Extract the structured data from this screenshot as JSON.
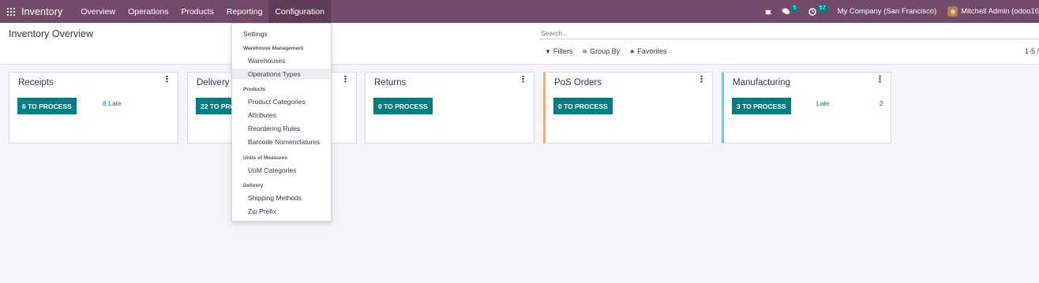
{
  "nav": {
    "brand": "Inventory",
    "menu": [
      "Overview",
      "Operations",
      "Products",
      "Reporting",
      "Configuration"
    ],
    "messages_count": "5",
    "activities_count": "57",
    "company": "My Company (San Francisco)",
    "user": "Mitchell Admin (odoo16"
  },
  "control": {
    "title": "Inventory Overview",
    "search_placeholder": "Search...",
    "filters_label": "Filters",
    "groupby_label": "Group By",
    "favorites_label": "Favorites",
    "pager": "1-5 /"
  },
  "cards": [
    {
      "title": "Receipts",
      "button": "6 TO PROCESS",
      "late": "6 Late",
      "count": ""
    },
    {
      "title": "Delivery Orders",
      "button": "22 TO PROCESS",
      "late": "",
      "count": ""
    },
    {
      "title": "Returns",
      "button": "0 TO PROCESS",
      "late": "",
      "count": ""
    },
    {
      "title": "PoS Orders",
      "button": "0 TO PROCESS",
      "late": "",
      "count": ""
    },
    {
      "title": "Manufacturing",
      "button": "3 TO PROCESS",
      "late": "Late",
      "count": "2"
    }
  ],
  "dropdown": {
    "settings": "Settings",
    "wm_header": "Warehouse Management",
    "warehouses": "Warehouses",
    "operations_types": "Operations Types",
    "products_header": "Products",
    "product_categories": "Product Categories",
    "attributes": "Attributes",
    "reordering_rules": "Reordering Rules",
    "barcode_nomenclatures": "Barcode Nomenclatures",
    "uom_header": "Units of Measures",
    "uom_categories": "UoM Categories",
    "delivery_header": "Delivery",
    "shipping_methods": "Shipping Methods",
    "zip_prefix": "Zip Prefix"
  },
  "colors": {
    "navbar": "#714b67",
    "primary": "#017e84",
    "pos_border": "#f0ad71",
    "mrp_border": "#7dc3e8"
  }
}
